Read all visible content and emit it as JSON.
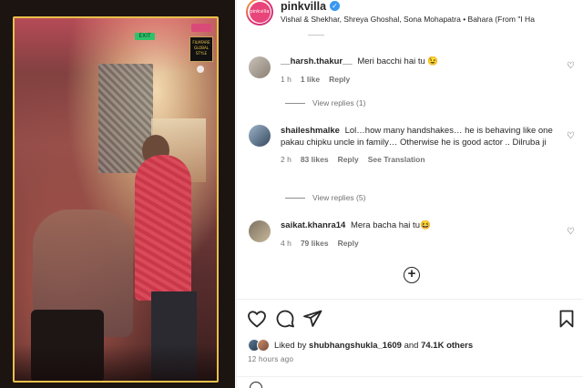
{
  "post": {
    "username": "pinkvilla",
    "avatar_text": "pinkvilla",
    "verified_icon": "verified-badge-icon",
    "audio": "Vishal & Shekhar, Shreya Ghoshal, Sona Mohapatra • Bahara (From \"I Ha"
  },
  "media": {
    "exit_label": "EXIT",
    "poster_label": "FILMFARE GLOBAL STYLE"
  },
  "comments": [
    {
      "user": "__harsh.thakur__",
      "text": "Meri bacchi hai tu 😉",
      "time": "1 h",
      "likes": "1 like",
      "reply": "Reply",
      "view_replies": "View replies (1)"
    },
    {
      "user": "shaileshmalke",
      "text": "Lol…how many handshakes… he is behaving like one pakau chipku uncle in family… Otherwise he is good actor .. Dilruba ji",
      "time": "2 h",
      "likes": "83 likes",
      "reply": "Reply",
      "translation": "See Translation",
      "view_replies": "View replies (5)"
    },
    {
      "user": "saikat.khanra14",
      "text": "Mera bacha hai tu😆",
      "time": "4 h",
      "likes": "79 likes",
      "reply": "Reply"
    }
  ],
  "likes": {
    "prefix": "Liked by",
    "top_liker": "shubhangshukla_1609",
    "joiner": "and",
    "others": "74.1K others"
  },
  "timestamp": "12 hours ago",
  "icons": [
    "heart-icon",
    "comment-icon",
    "share-icon",
    "bookmark-icon",
    "add-circle-icon",
    "emoji-icon"
  ],
  "colors": {
    "accent": "#e1306c",
    "frame": "#e8c04a",
    "verified": "#3897f0",
    "muted": "#737373"
  }
}
